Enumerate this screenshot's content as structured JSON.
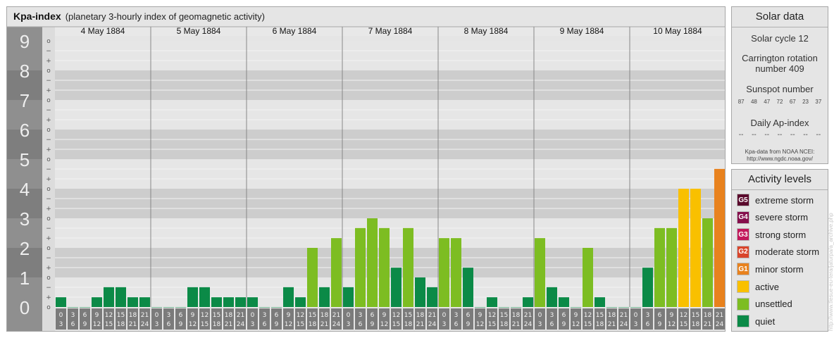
{
  "chart": {
    "title": "Kpa-index",
    "subtitle": "(planetary 3-hourly index of geomagnetic activity)"
  },
  "chart_data": {
    "type": "bar",
    "title": "Kpa-index",
    "subtitle": "(planetary 3-hourly index of geomagnetic activity)",
    "ylim": [
      0,
      9
    ],
    "y_ticks": [
      "0",
      "1",
      "2",
      "3",
      "4",
      "5",
      "6",
      "7",
      "8",
      "9"
    ],
    "y_minor_ticks": [
      "o",
      "+",
      "−"
    ],
    "days": [
      "4 May 1884",
      "5 May 1884",
      "6 May 1884",
      "7 May 1884",
      "8 May 1884",
      "9 May 1884",
      "10 May 1884"
    ],
    "intervals": [
      {
        "start": "0",
        "end": "3"
      },
      {
        "start": "3",
        "end": "6"
      },
      {
        "start": "6",
        "end": "9"
      },
      {
        "start": "9",
        "end": "12"
      },
      {
        "start": "12",
        "end": "15"
      },
      {
        "start": "15",
        "end": "18"
      },
      {
        "start": "18",
        "end": "21"
      },
      {
        "start": "21",
        "end": "24"
      }
    ],
    "values": [
      0.33,
      0,
      0,
      0.33,
      0.67,
      0.67,
      0.33,
      0.33,
      0,
      0,
      0,
      0.67,
      0.67,
      0.33,
      0.33,
      0.33,
      0.33,
      0,
      0,
      0.67,
      0.33,
      2,
      0.67,
      2.33,
      0.67,
      2.67,
      3,
      2.67,
      1.33,
      2.67,
      1,
      0.67,
      2.33,
      2.33,
      1.33,
      0,
      0.33,
      0,
      0,
      0.33,
      2.33,
      0.67,
      0.33,
      0,
      2,
      0.33,
      0,
      0,
      0,
      1.33,
      2.67,
      2.67,
      4,
      4,
      3,
      4.67
    ],
    "levels": [
      "quiet",
      "quiet",
      "quiet",
      "quiet",
      "quiet",
      "quiet",
      "quiet",
      "quiet",
      "quiet",
      "quiet",
      "quiet",
      "quiet",
      "quiet",
      "quiet",
      "quiet",
      "quiet",
      "quiet",
      "quiet",
      "quiet",
      "quiet",
      "quiet",
      "unsettled",
      "quiet",
      "unsettled",
      "quiet",
      "unsettled",
      "unsettled",
      "unsettled",
      "quiet",
      "unsettled",
      "quiet",
      "quiet",
      "unsettled",
      "unsettled",
      "quiet",
      "quiet",
      "quiet",
      "quiet",
      "quiet",
      "quiet",
      "unsettled",
      "quiet",
      "quiet",
      "quiet",
      "unsettled",
      "quiet",
      "quiet",
      "quiet",
      "quiet",
      "quiet",
      "unsettled",
      "unsettled",
      "active",
      "active",
      "unsettled",
      "minor storm"
    ]
  },
  "solar": {
    "header": "Solar data",
    "cycle": "Solar cycle 12",
    "carrington": "Carrington rotation number 409",
    "sunspot_label": "Sunspot number",
    "sunspot_values": [
      "87",
      "48",
      "47",
      "72",
      "67",
      "23",
      "37"
    ],
    "ap_label": "Daily Ap-index",
    "ap_values": [
      "--",
      "--",
      "--",
      "--",
      "--",
      "--",
      "--"
    ],
    "credit_line1": "Kpa-data from NOAA NCEI:",
    "credit_line2": "http://www.ngdc.noaa.gov/"
  },
  "levels": {
    "header": "Activity levels",
    "items": [
      {
        "code": "G5",
        "label": "extreme storm",
        "color": "#5a0a2c"
      },
      {
        "code": "G4",
        "label": "severe storm",
        "color": "#850f4c"
      },
      {
        "code": "G3",
        "label": "strong storm",
        "color": "#c2185b"
      },
      {
        "code": "G2",
        "label": "moderate storm",
        "color": "#d9452b"
      },
      {
        "code": "G1",
        "label": "minor storm",
        "color": "#e8821e"
      },
      {
        "code": "",
        "label": "active",
        "color": "#f9c000"
      },
      {
        "code": "",
        "label": "unsettled",
        "color": "#7dbd22"
      },
      {
        "code": "",
        "label": "quiet",
        "color": "#0b8a47"
      }
    ]
  },
  "colors": {
    "quiet": "#0b8a47",
    "unsettled": "#7dbd22",
    "active": "#f9c000",
    "minor storm": "#e8821e"
  },
  "watermark": "http://www.tlesue-eu-tera/jaturpa/a_archive.php"
}
